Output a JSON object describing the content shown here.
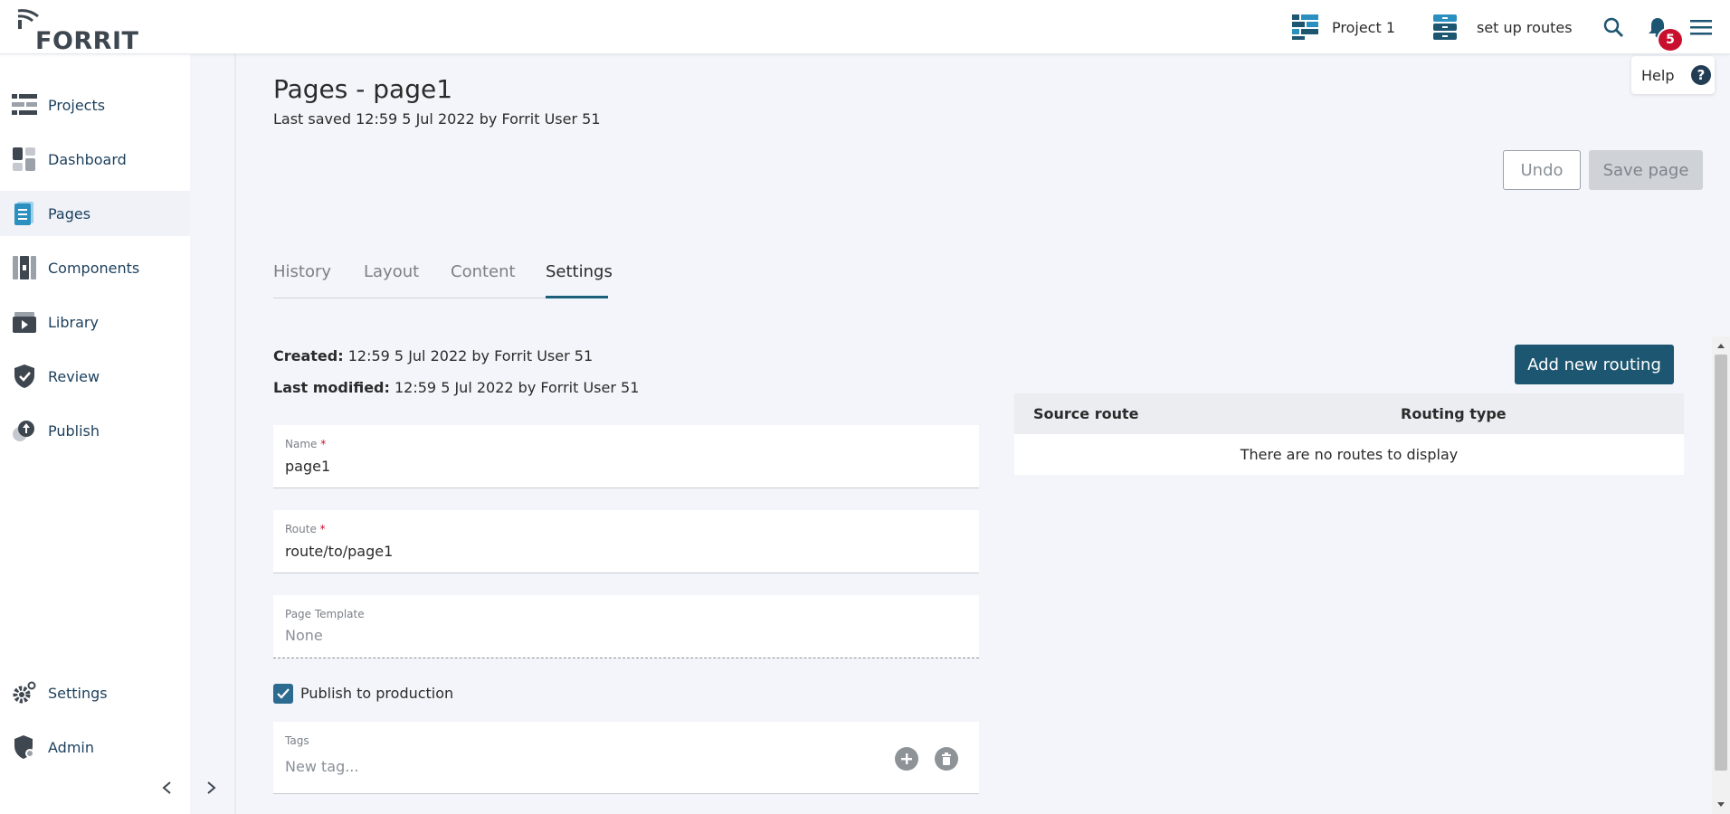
{
  "brand": {
    "logo_text": "FORRIT"
  },
  "header": {
    "project_label": "Project 1",
    "task_label": "set up routes",
    "notifications_count": "5"
  },
  "sidebar": {
    "items": [
      {
        "label": "Projects"
      },
      {
        "label": "Dashboard"
      },
      {
        "label": "Pages"
      },
      {
        "label": "Components"
      },
      {
        "label": "Library"
      },
      {
        "label": "Review"
      },
      {
        "label": "Publish"
      }
    ],
    "bottom": [
      {
        "label": "Settings"
      },
      {
        "label": "Admin"
      }
    ],
    "active": "Pages"
  },
  "page": {
    "title": "Pages - page1",
    "last_saved": "Last saved 12:59 5 Jul 2022 by Forrit User 51",
    "help_label": "Help",
    "undo_label": "Undo",
    "save_label": "Save page"
  },
  "tabs": [
    {
      "label": "History"
    },
    {
      "label": "Layout"
    },
    {
      "label": "Content"
    },
    {
      "label": "Settings"
    }
  ],
  "active_tab": "Settings",
  "settings": {
    "created_label": "Created:",
    "created_value": "12:59 5 Jul 2022 by Forrit User 51",
    "modified_label": "Last modified:",
    "modified_value": "12:59 5 Jul 2022 by Forrit User 51",
    "name_label": "Name",
    "name_value": "page1",
    "route_label": "Route",
    "route_value": "route/to/page1",
    "template_label": "Page Template",
    "template_value": "None",
    "publish_label": "Publish to production",
    "publish_checked": true,
    "tags_label": "Tags",
    "tags_placeholder": "New tag..."
  },
  "routing": {
    "add_label": "Add new routing",
    "col_source": "Source route",
    "col_type": "Routing type",
    "empty_message": "There are no routes to display"
  },
  "colors": {
    "brand_dark": "#1d5670",
    "nav_text": "#1b3f5c",
    "badge": "#c8102e"
  }
}
